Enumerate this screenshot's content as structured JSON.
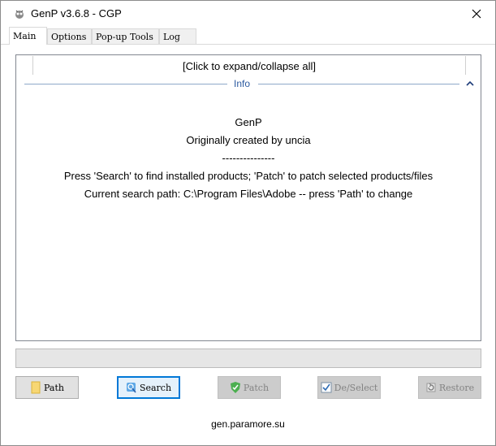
{
  "window": {
    "title": "GenP v3.6.8 - CGP",
    "close_glyph": "✕"
  },
  "tabs": [
    {
      "label": "Main",
      "active": true
    },
    {
      "label": "Options",
      "active": false
    },
    {
      "label": "Pop-up Tools",
      "active": false
    },
    {
      "label": "Log",
      "active": false
    }
  ],
  "panel": {
    "expand_collapse": "[Click to expand/collapse all]",
    "section_label": "Info",
    "lines": [
      "GenP",
      "Originally created by uncia",
      "---------------",
      "Press 'Search' to find installed products; 'Patch' to patch selected products/files",
      "Current search path: C:\\Program Files\\Adobe -- press 'Path' to change"
    ]
  },
  "progress": {
    "value": 0
  },
  "buttons": {
    "path": {
      "label": "Path",
      "icon": "folder-icon",
      "enabled": true
    },
    "search": {
      "label": "Search",
      "icon": "search-icon",
      "enabled": true,
      "focused": true
    },
    "patch": {
      "label": "Patch",
      "icon": "shield-check-icon",
      "enabled": false
    },
    "deselect": {
      "label": "De/Select",
      "icon": "checkbox-icon",
      "enabled": false
    },
    "restore": {
      "label": "Restore",
      "icon": "restore-icon",
      "enabled": false
    }
  },
  "footer": {
    "text": "gen.paramore.su"
  },
  "colors": {
    "accent": "#0078d7",
    "info_label": "#2c5aa0",
    "progress_fill": "#06b025"
  }
}
